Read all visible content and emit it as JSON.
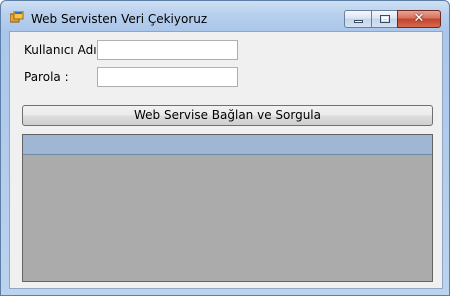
{
  "window": {
    "title": "Web Servisten Veri Çekiyoruz",
    "icon": "app-form-icon",
    "controls": {
      "minimize_icon": "minimize-icon",
      "maximize_icon": "maximize-icon",
      "close_icon": "close-icon",
      "close_glyph": "✕"
    }
  },
  "form": {
    "username_label": "Kullanıcı Adı :",
    "username_value": "",
    "password_label": "Parola :",
    "password_value": "",
    "query_button_label": "Web Servise Bağlan ve Sorgula"
  },
  "grid": {
    "columns": [],
    "rows": []
  },
  "colors": {
    "titlebar": "#b9d1ee",
    "client_background": "#f0f0f0",
    "grid_background": "#ababab",
    "grid_header": "#9fb7d2",
    "close_button": "#c0432d"
  }
}
